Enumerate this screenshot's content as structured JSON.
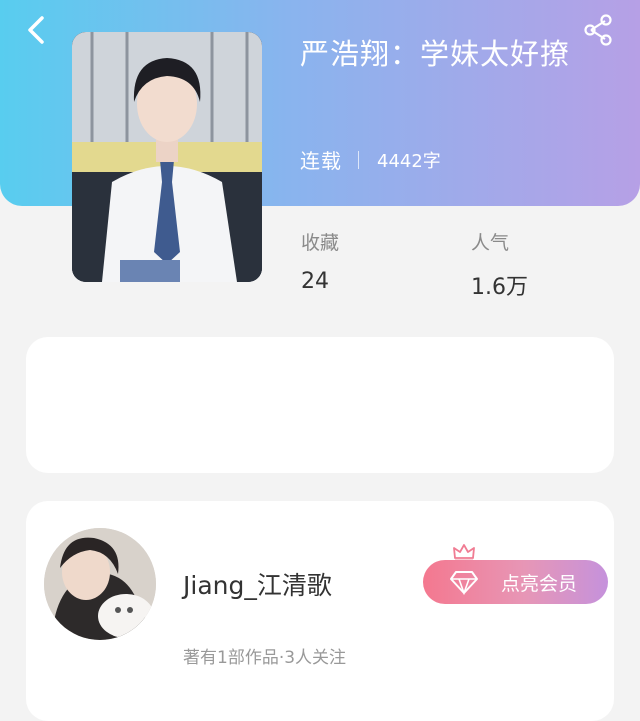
{
  "book": {
    "title": "严浩翔：学妹太好撩",
    "status": "连载",
    "word_count": "4442字"
  },
  "stats": [
    {
      "label": "收藏",
      "value": "24"
    },
    {
      "label": "人气",
      "value": "1.6万"
    }
  ],
  "author": {
    "name": "Jiang_江清歌",
    "summary": "著有1部作品·3人关注"
  },
  "vip_button": {
    "label": "点亮会员"
  },
  "icons": {
    "back": "chevron-left-icon",
    "share": "share-icon",
    "vip": "diamond-icon",
    "crown": "crown-icon"
  },
  "colors": {
    "header_gradient_start": "#58cdef",
    "header_gradient_end": "#b6a0e6",
    "vip_gradient_start": "#f4788f",
    "vip_gradient_end": "#c592dc",
    "page_background": "#f3f3f3"
  }
}
